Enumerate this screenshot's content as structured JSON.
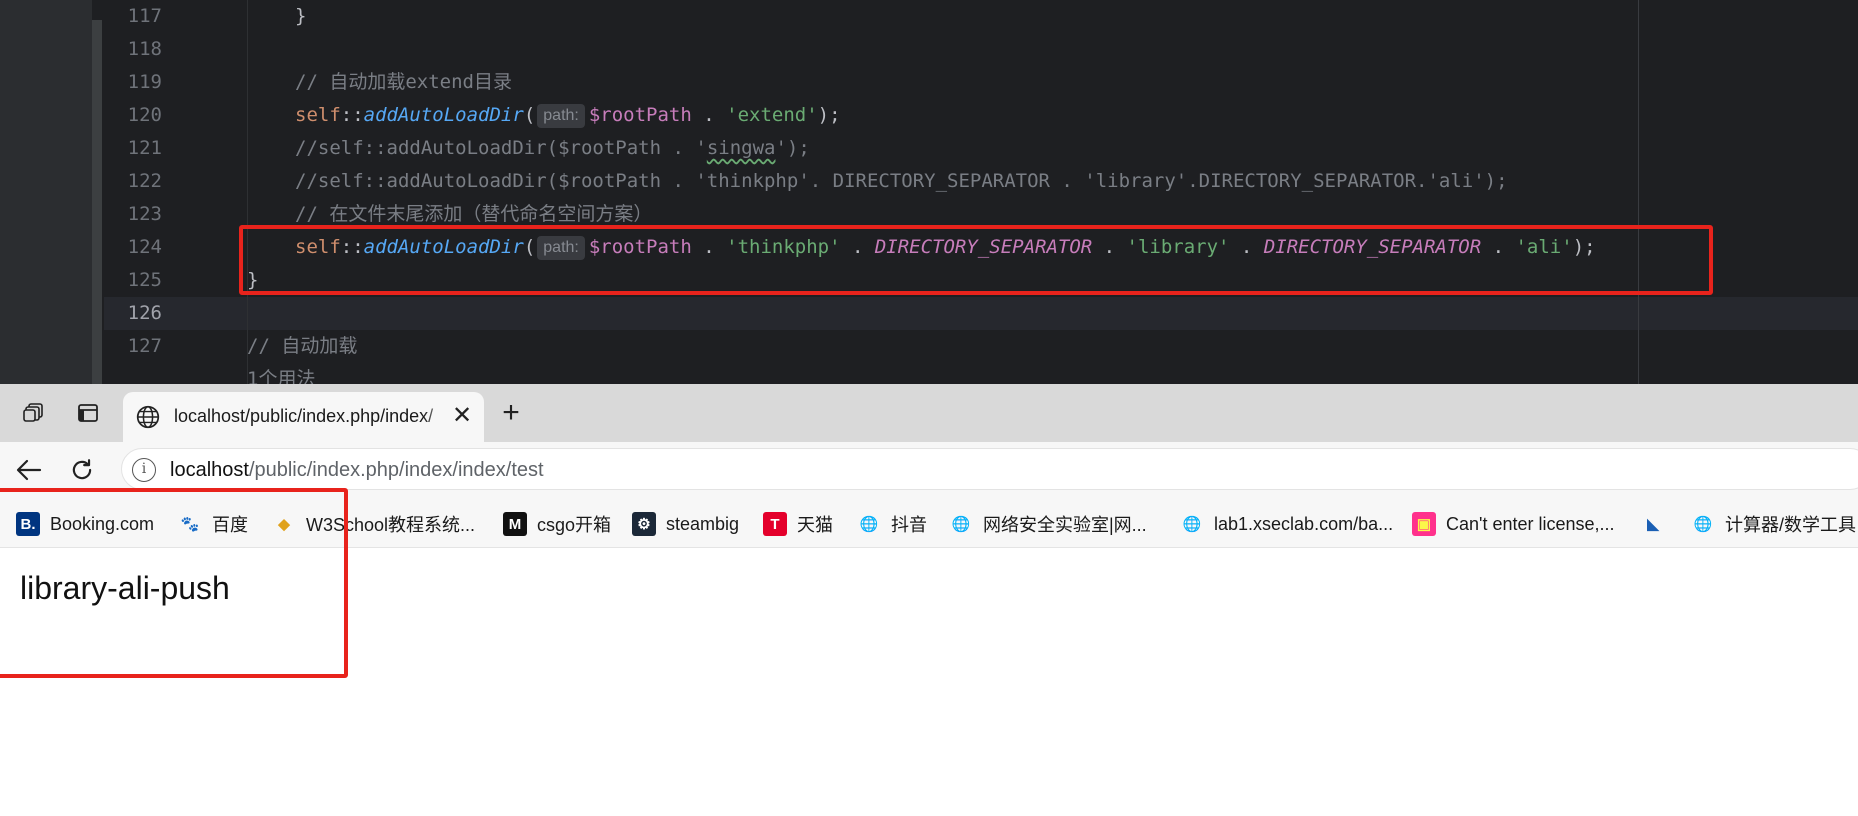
{
  "ide": {
    "lines": [
      {
        "num": "117",
        "tokens": [
          {
            "t": "}",
            "c": "c-pun"
          }
        ],
        "indent": 1
      },
      {
        "num": "118",
        "tokens": [],
        "indent": 1
      },
      {
        "num": "119",
        "tokens": [
          {
            "t": "// 自动加载extend目录",
            "c": "c-cmt"
          }
        ],
        "indent": 1
      },
      {
        "num": "120",
        "tokens": [
          {
            "t": "self",
            "c": "c-kw"
          },
          {
            "t": "::",
            "c": "c-pun"
          },
          {
            "t": "addAutoLoadDir",
            "c": "c-fn"
          },
          {
            "t": "(",
            "c": "c-pun"
          },
          {
            "hint": "path:"
          },
          {
            "t": "$rootPath",
            "c": "c-var"
          },
          {
            "t": " . ",
            "c": "c-pun"
          },
          {
            "t": "'extend'",
            "c": "c-str"
          },
          {
            "t": ");",
            "c": "c-pun"
          }
        ],
        "indent": 1
      },
      {
        "num": "121",
        "tokens": [
          {
            "t": "//self::addAutoLoadDir($rootPath . '",
            "c": "c-cmt"
          },
          {
            "t": "singwa",
            "c": "c-cmt squiggle"
          },
          {
            "t": "');",
            "c": "c-cmt"
          }
        ],
        "indent": 1
      },
      {
        "num": "122",
        "tokens": [
          {
            "t": "//self::addAutoLoadDir($rootPath . 'thinkphp'. DIRECTORY_SEPARATOR . 'library'.DIRECTORY_SEPARATOR.'ali');",
            "c": "c-cmt"
          }
        ],
        "indent": 1
      },
      {
        "num": "123",
        "tokens": [
          {
            "t": "// 在文件末尾添加（替代命名空间方案）",
            "c": "c-cmt"
          }
        ],
        "indent": 1
      },
      {
        "num": "124",
        "tokens": [
          {
            "t": "self",
            "c": "c-kw"
          },
          {
            "t": "::",
            "c": "c-pun"
          },
          {
            "t": "addAutoLoadDir",
            "c": "c-fn"
          },
          {
            "t": "(",
            "c": "c-pun"
          },
          {
            "hint": "path:"
          },
          {
            "t": "$rootPath",
            "c": "c-var"
          },
          {
            "t": " . ",
            "c": "c-pun"
          },
          {
            "t": "'thinkphp'",
            "c": "c-str"
          },
          {
            "t": " . ",
            "c": "c-pun"
          },
          {
            "t": "DIRECTORY_SEPARATOR",
            "c": "c-const"
          },
          {
            "t": " . ",
            "c": "c-pun"
          },
          {
            "t": "'library'",
            "c": "c-str"
          },
          {
            "t": " . ",
            "c": "c-pun"
          },
          {
            "t": "DIRECTORY_SEPARATOR",
            "c": "c-const"
          },
          {
            "t": " . ",
            "c": "c-pun"
          },
          {
            "t": "'ali'",
            "c": "c-str"
          },
          {
            "t": ");",
            "c": "c-pun"
          }
        ],
        "indent": 1
      },
      {
        "num": "125",
        "tokens": [
          {
            "t": "}",
            "c": "c-pun"
          }
        ],
        "indent": 0
      },
      {
        "num": "126",
        "tokens": [],
        "indent": 0,
        "current": true
      },
      {
        "num": "127",
        "tokens": [
          {
            "t": "// 自动加载",
            "c": "c-cmt"
          }
        ],
        "indent": 0
      },
      {
        "num": "",
        "tokens": [
          {
            "t": "1个用法",
            "c": "c-cmt"
          }
        ],
        "indent": 0
      }
    ]
  },
  "browser": {
    "tab": {
      "title": "localhost/public/index.php/index/",
      "close": "✕"
    },
    "new_tab": "+",
    "address": {
      "host": "localhost",
      "path": "/public/index.php/index/index/test"
    },
    "bookmarks": [
      {
        "label": "Booking.com",
        "icon": "booking-icon",
        "glyph": "B.",
        "bg": "#003580",
        "fg": "#ffffff"
      },
      {
        "label": "百度",
        "icon": "baidu-icon",
        "glyph": "🐾",
        "bg": "transparent",
        "fg": "#2932e1"
      },
      {
        "label": "W3School教程系统...",
        "icon": "w3school-icon",
        "glyph": "◆",
        "bg": "transparent",
        "fg": "#e0a21c"
      },
      {
        "label": "csgo开箱",
        "icon": "csgo-icon",
        "glyph": "M",
        "bg": "#111111",
        "fg": "#ffffff"
      },
      {
        "label": "steambig",
        "icon": "steam-icon",
        "glyph": "⚙",
        "bg": "#1b2838",
        "fg": "#ffffff"
      },
      {
        "label": "天猫",
        "icon": "tmall-icon",
        "glyph": "T",
        "bg": "#e4002b",
        "fg": "#ffffff"
      },
      {
        "label": "抖音",
        "icon": "globe-icon",
        "glyph": "🌐",
        "bg": "transparent",
        "fg": "#333333"
      },
      {
        "label": "网络安全实验室|网...",
        "icon": "globe-icon",
        "glyph": "🌐",
        "bg": "transparent",
        "fg": "#333333"
      },
      {
        "label": "lab1.xseclab.com/ba...",
        "icon": "globe-icon",
        "glyph": "🌐",
        "bg": "transparent",
        "fg": "#333333"
      },
      {
        "label": "Can't enter license,...",
        "icon": "jetbrains-icon",
        "glyph": "▣",
        "bg": "#ff318c",
        "fg": "#fcf84a"
      },
      {
        "label": "",
        "icon": "app-icon",
        "glyph": "◣",
        "bg": "transparent",
        "fg": "#1a5fb4"
      },
      {
        "label": "计算器/数学工具",
        "icon": "globe-icon",
        "glyph": "🌐",
        "bg": "transparent",
        "fg": "#333333"
      }
    ],
    "page": {
      "text": "library-ali-push"
    }
  },
  "colors": {
    "highlight_box": "#e8231c"
  }
}
